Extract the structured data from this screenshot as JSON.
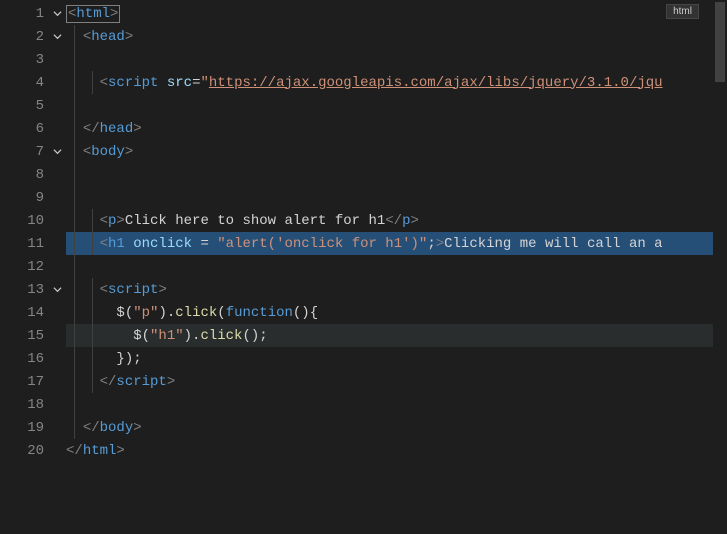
{
  "lang_badge": "html",
  "lines": [
    {
      "num": "1",
      "fold": "v"
    },
    {
      "num": "2",
      "fold": "v"
    },
    {
      "num": "3",
      "fold": ""
    },
    {
      "num": "4",
      "fold": ""
    },
    {
      "num": "5",
      "fold": ""
    },
    {
      "num": "6",
      "fold": ""
    },
    {
      "num": "7",
      "fold": "v"
    },
    {
      "num": "8",
      "fold": ""
    },
    {
      "num": "9",
      "fold": ""
    },
    {
      "num": "10",
      "fold": ""
    },
    {
      "num": "11",
      "fold": ""
    },
    {
      "num": "12",
      "fold": ""
    },
    {
      "num": "13",
      "fold": "v"
    },
    {
      "num": "14",
      "fold": ""
    },
    {
      "num": "15",
      "fold": ""
    },
    {
      "num": "16",
      "fold": ""
    },
    {
      "num": "17",
      "fold": ""
    },
    {
      "num": "18",
      "fold": ""
    },
    {
      "num": "19",
      "fold": ""
    },
    {
      "num": "20",
      "fold": ""
    }
  ],
  "code": {
    "l1_open": "<",
    "l1_tag": "html",
    "l1_close": ">",
    "l2_indent": "  ",
    "l2_open": "<",
    "l2_tag": "head",
    "l2_close": ">",
    "l4_indent": "    ",
    "l4_open": "<",
    "l4_tag": "script",
    "l4_sp": " ",
    "l4_attr": "src",
    "l4_eq": "=",
    "l4_q": "\"",
    "l4_url": "https://ajax.googleapis.com/ajax/libs/jquery/3.1.0/jqu",
    "l6_indent": "  ",
    "l6_open": "</",
    "l6_tag": "head",
    "l6_close": ">",
    "l7_indent": "  ",
    "l7_open": "<",
    "l7_tag": "body",
    "l7_close": ">",
    "l10_indent": "    ",
    "l10_open": "<",
    "l10_tag": "p",
    "l10_close": ">",
    "l10_text": "Click here to show alert for h1",
    "l10_open2": "</",
    "l10_tag2": "p",
    "l10_close2": ">",
    "l11_indent": "    ",
    "l11_open": "<",
    "l11_tag": "h1",
    "l11_sp": " ",
    "l11_attr": "onclick",
    "l11_sp2": " ",
    "l11_eq": "=",
    "l11_sp3": " ",
    "l11_q": "\"",
    "l11_val": "alert('onclick for h1')",
    "l11_q2": "\"",
    "l11_semi": ";",
    "l11_close": ">",
    "l11_text": "Clicking me will call an a",
    "l13_indent": "    ",
    "l13_open": "<",
    "l13_tag": "script",
    "l13_close": ">",
    "l14_indent": "      ",
    "l14_a": "$(",
    "l14_str": "\"p\"",
    "l14_b": ").",
    "l14_fn1": "click",
    "l14_c": "(",
    "l14_kw": "function",
    "l14_d": "(){",
    "l15_indent": "        ",
    "l15_a": "$(",
    "l15_str": "\"h1\"",
    "l15_b": ").",
    "l15_fn": "click",
    "l15_c": "();",
    "l16_indent": "      ",
    "l16_a": "});",
    "l17_indent": "    ",
    "l17_open": "</",
    "l17_tag": "script",
    "l17_close": ">",
    "l19_indent": "  ",
    "l19_open": "</",
    "l19_tag": "body",
    "l19_close": ">",
    "l20_open": "</",
    "l20_tag": "html",
    "l20_close": ">"
  }
}
